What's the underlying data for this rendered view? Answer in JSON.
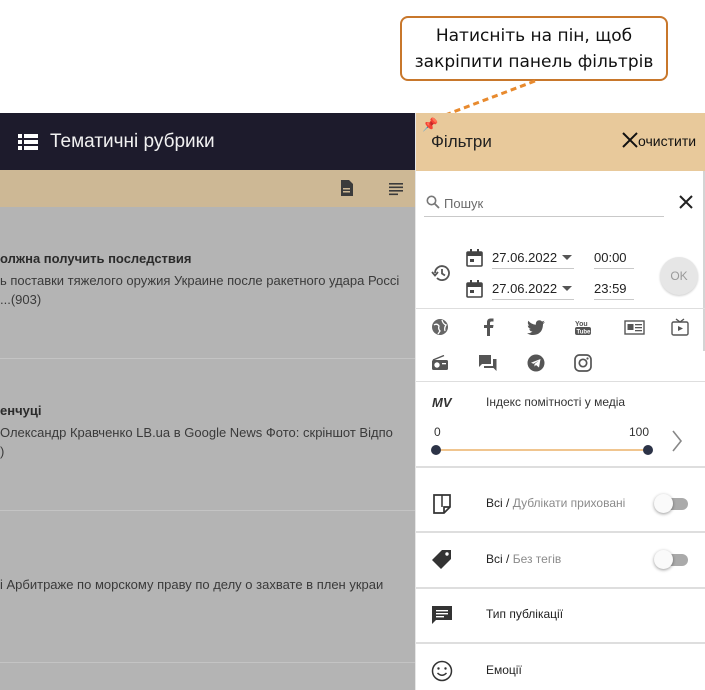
{
  "callout": {
    "line1": "Натисніть на пін, щоб",
    "line2": "закріпити панель фільтрів"
  },
  "header": {
    "title": "Тематичні рубрики"
  },
  "articles": [
    {
      "title": "олжна получить последствия",
      "line1": "ь поставки тяжелого оружия Украине после ракетного удара Россі",
      "line2": "...(903)"
    },
    {
      "title": "енчуці",
      "line1": "Олександр Кравченко LB.ua в Google News Фото: скріншот Відпо",
      "line2": ")"
    },
    {
      "title": "",
      "line1": "і Арбитраже по морскому праву по делу о захвате в плен украи",
      "line2": ""
    }
  ],
  "filters": {
    "title": "Фільтри",
    "clear_label": "очистити",
    "search_placeholder": "Пошук",
    "date_from": "27.06.2022",
    "time_from": "00:00",
    "date_to": "27.06.2022",
    "time_to": "23:59",
    "ok_label": "OK",
    "sources_row1": [
      "globe-icon",
      "facebook-icon",
      "twitter-icon",
      "youtube-icon",
      "news-icon",
      "tv-icon"
    ],
    "sources_row2": [
      "radio-icon",
      "forum-icon",
      "telegram-icon",
      "instagram-icon"
    ],
    "mv_label": "MV",
    "index_label": "Індекс помітності у медіа",
    "range_min": "0",
    "range_max": "100",
    "range_low": 0,
    "range_high": 100,
    "duplicates": {
      "all": "Всі",
      "sep": " / ",
      "label": "Дублікати приховані",
      "on": false
    },
    "tags": {
      "all": "Всі",
      "sep": " / ",
      "label": "Без тегів",
      "on": false
    },
    "pub_type": "Тип публікації",
    "emotions": "Емоції"
  },
  "colors": {
    "header_bg": "#1d1b2c",
    "panel_head_bg": "#e8c99b",
    "callout_border": "#c8772b",
    "overlay": "#b4b4b4"
  }
}
